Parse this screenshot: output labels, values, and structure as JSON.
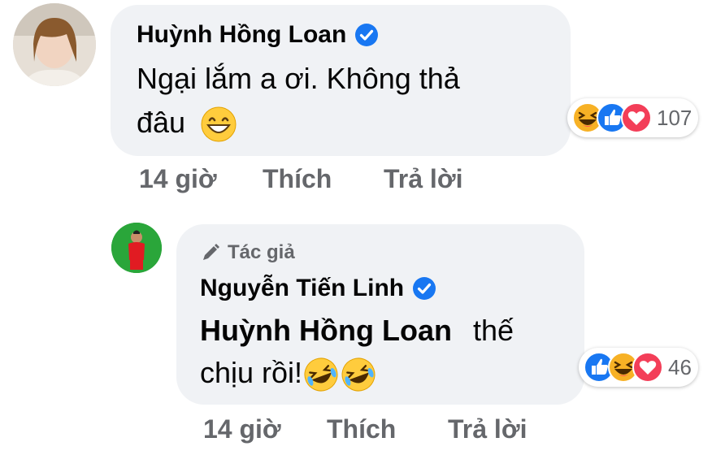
{
  "comments": [
    {
      "author": "Huỳnh Hồng Loan",
      "text_line1": "Ngại lắm a ơi. Không thả",
      "text_line2": "đâu",
      "time": "14 giờ",
      "like_label": "Thích",
      "reply_label": "Trả lời",
      "reaction_count": "107",
      "reaction_icons": [
        "haha-icon",
        "like-icon",
        "love-icon"
      ]
    },
    {
      "badge": "Tác giả",
      "author": "Nguyễn Tiến Linh",
      "mention": "Huỳnh Hồng Loan",
      "text_line1_rest": "thế",
      "text_line2": "chịu rồi!",
      "time": "14 giờ",
      "like_label": "Thích",
      "reply_label": "Trả lời",
      "reaction_count": "46",
      "reaction_icons": [
        "like-icon",
        "haha-icon",
        "love-icon"
      ]
    }
  ],
  "colors": {
    "bubble": "#f0f2f5",
    "meta": "#65676b",
    "verified": "#1877f2",
    "like": "#1877f2",
    "love": "#f33e58",
    "haha": "#f7b125"
  }
}
